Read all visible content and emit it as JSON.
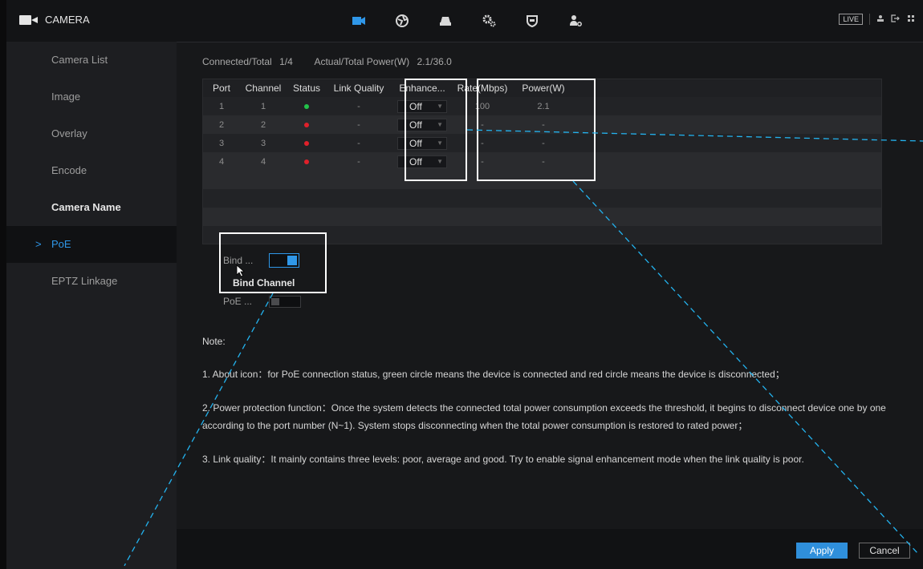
{
  "app": {
    "title": "CAMERA"
  },
  "nav_icons": [
    "camera-icon",
    "network-globe-icon",
    "storage-icon",
    "system-gears-icon",
    "security-shield-icon",
    "account-icon"
  ],
  "top_right": {
    "live_label": "LIVE"
  },
  "sidebar": {
    "items": [
      {
        "label": "Camera List",
        "state": "normal"
      },
      {
        "label": "Image",
        "state": "normal"
      },
      {
        "label": "Overlay",
        "state": "normal"
      },
      {
        "label": "Encode",
        "state": "normal"
      },
      {
        "label": "Camera Name",
        "state": "bold"
      },
      {
        "label": "PoE",
        "state": "active"
      },
      {
        "label": "EPTZ Linkage",
        "state": "normal"
      }
    ],
    "active_marker": ">"
  },
  "summary": {
    "connected_label": "Connected/Total",
    "connected_value": "1/4",
    "power_label": "Actual/Total Power(W)",
    "power_value": "2.1/36.0"
  },
  "table": {
    "headers": [
      "Port",
      "Channel",
      "Status",
      "Link Quality",
      "Enhance...",
      "Rate(Mbps)",
      "Power(W)"
    ],
    "rows": [
      {
        "port": "1",
        "channel": "1",
        "status": "connected",
        "link_quality": "-",
        "enhance": "Off",
        "rate": "100",
        "power": "2.1"
      },
      {
        "port": "2",
        "channel": "2",
        "status": "disconnected",
        "link_quality": "-",
        "enhance": "Off",
        "rate": "-",
        "power": "-"
      },
      {
        "port": "3",
        "channel": "3",
        "status": "disconnected",
        "link_quality": "-",
        "enhance": "Off",
        "rate": "-",
        "power": "-"
      },
      {
        "port": "4",
        "channel": "4",
        "status": "disconnected",
        "link_quality": "-",
        "enhance": "Off",
        "rate": "-",
        "power": "-"
      }
    ]
  },
  "options": {
    "bind_label": "Bind ...",
    "bind_enabled": true,
    "bind_tooltip": "Bind Channel",
    "poe_label": "PoE ...",
    "poe_enabled": false
  },
  "notes": {
    "heading": "Note:",
    "items": [
      "1. About icon：for PoE connection status, green circle means the device is connected and red circle means the device is disconnected；",
      "2. Power protection function：Once the system detects the connected total power consumption exceeds the threshold, it begins to disconnect device one by one according to the port number (N~1). System stops disconnecting when the total power consumption is restored to rated power；",
      "3. Link quality：It mainly contains three levels: poor, average and good. Try to enable signal enhancement mode when the link quality is poor."
    ]
  },
  "footer": {
    "apply_label": "Apply",
    "cancel_label": "Cancel"
  },
  "colors": {
    "accent": "#2f97e8",
    "connected": "#22c34a",
    "disconnected": "#e0202a",
    "annotation_line": "#23b3ef",
    "highlight_box": "#ffffff"
  }
}
